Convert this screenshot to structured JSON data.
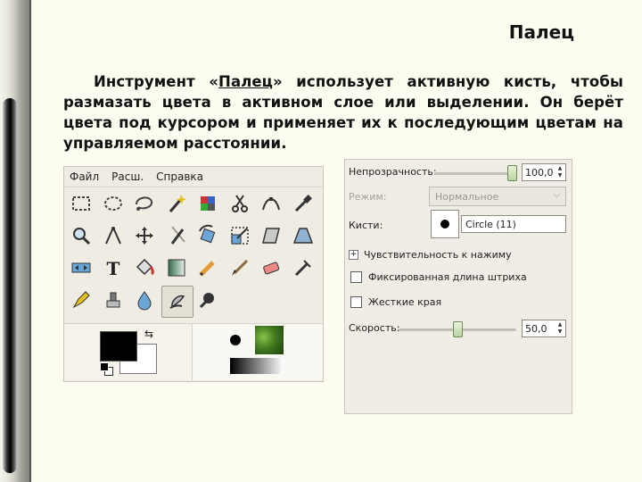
{
  "slide": {
    "title": "Палец",
    "paragraph_before": "Инструмент «",
    "paragraph_link": "Палец",
    "paragraph_after": "» использует активную кисть, чтобы размазать цвета в активном слое или выделении. Он берёт цвета под курсором и применяет их к последующим цветам на управляемом расстоянии."
  },
  "toolbox": {
    "menu": [
      "Файл",
      "Расш.",
      "Справка"
    ],
    "tools": [
      {
        "icon": "rect-select-icon"
      },
      {
        "icon": "ellipse-select-icon"
      },
      {
        "icon": "free-select-icon"
      },
      {
        "icon": "fuzzy-select-icon"
      },
      {
        "icon": "color-select-icon"
      },
      {
        "icon": "scissors-select-icon"
      },
      {
        "icon": "paths-icon"
      },
      {
        "icon": "color-picker-icon"
      },
      {
        "icon": "zoom-icon"
      },
      {
        "icon": "measure-icon"
      },
      {
        "icon": "move-icon"
      },
      {
        "icon": "crop-icon"
      },
      {
        "icon": "rotate-icon"
      },
      {
        "icon": "scale-icon"
      },
      {
        "icon": "shear-icon"
      },
      {
        "icon": "perspective-icon"
      },
      {
        "icon": "flip-icon"
      },
      {
        "icon": "text-icon"
      },
      {
        "icon": "bucket-fill-icon"
      },
      {
        "icon": "blend-icon"
      },
      {
        "icon": "pencil-icon"
      },
      {
        "icon": "paintbrush-icon"
      },
      {
        "icon": "eraser-icon"
      },
      {
        "icon": "airbrush-icon"
      },
      {
        "icon": "ink-icon"
      },
      {
        "icon": "clone-icon"
      },
      {
        "icon": "blur-icon"
      },
      {
        "icon": "smudge-icon"
      },
      {
        "icon": "dodge-burn-icon"
      }
    ],
    "active_tool": "smudge-icon",
    "fg_color": "#000000",
    "bg_color": "#ffffff"
  },
  "options": {
    "opacity_label": "Непрозрачность:",
    "opacity_value": "100,0",
    "opacity_level": 1.0,
    "mode_label": "Режим:",
    "mode_value": "Нормальное",
    "brush_label": "Кисти:",
    "brush_name": "Circle (11)",
    "sensitivity_label": "Чувствительность к нажиму",
    "fixed_length_label": "Фиксированная длина штриха",
    "hard_edge_label": "Жесткие края",
    "rate_label": "Скорость:",
    "rate_value": "50,0",
    "rate_level": 0.5
  }
}
